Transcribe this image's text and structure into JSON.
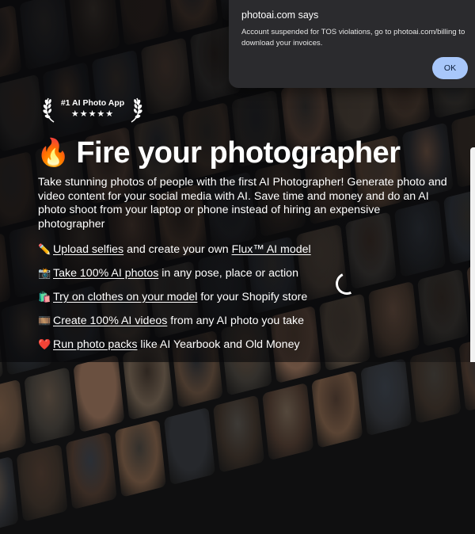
{
  "badge": {
    "title": "#1 AI Photo App",
    "stars": "★★★★★"
  },
  "headline": {
    "emoji": "🔥",
    "title": "Fire your photographer"
  },
  "intro": "Take stunning photos of people with the first AI Photographer! Generate photo and video content for your social media with AI. Save time and money and do an AI photo shoot from your laptop or phone instead of hiring an expensive photographer",
  "features": [
    {
      "emoji": "✏️",
      "link": "Upload selfies",
      "text1": " and create your own ",
      "link2": "Flux™ AI model",
      "text2": ""
    },
    {
      "emoji": "📸",
      "link": "Take 100% AI photos",
      "text1": " in any pose, place or action",
      "link2": "",
      "text2": ""
    },
    {
      "emoji": "🛍️",
      "link": "Try on clothes on your model",
      "text1": " for your Shopify store",
      "link2": "",
      "text2": ""
    },
    {
      "emoji": "🎞️",
      "link": "Create 100% AI videos",
      "text1": " from any AI photo you take",
      "link2": "",
      "text2": ""
    },
    {
      "emoji": "❤️",
      "link": "Run photo packs",
      "text1": " like AI Yearbook and Old Money",
      "link2": "",
      "text2": ""
    }
  ],
  "dialog": {
    "site": "photoai.com says",
    "message": "Account suspended for TOS violations, go to photoai.com/billing to download your invoices.",
    "ok_label": "OK"
  },
  "icons": {
    "laurel": "laurel-wreath-icon",
    "spinner": "loading-spinner-icon"
  }
}
